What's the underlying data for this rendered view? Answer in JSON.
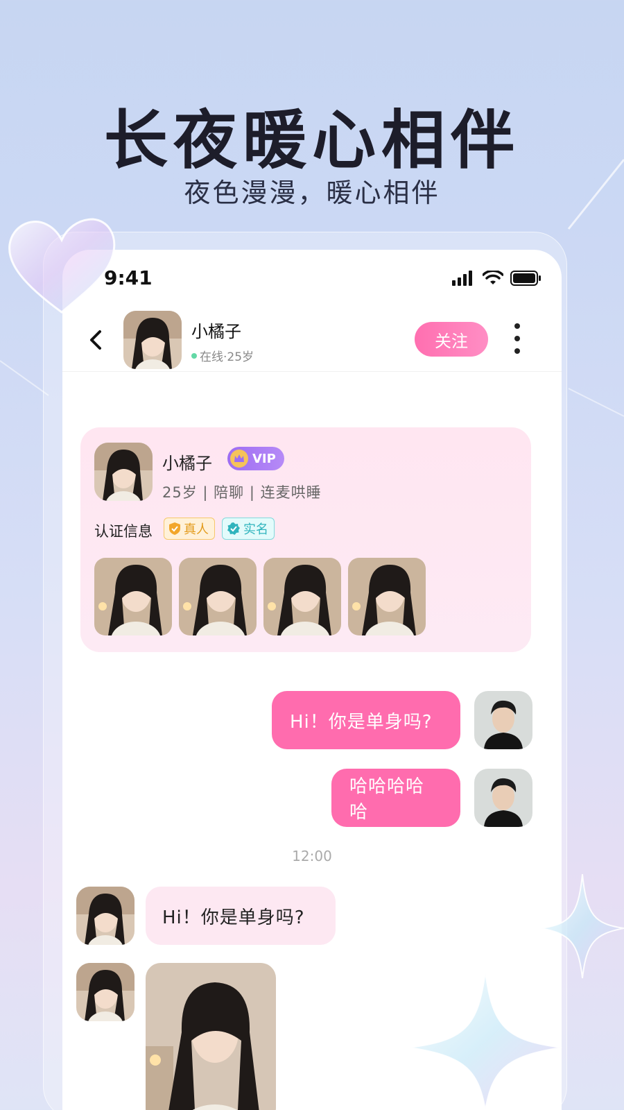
{
  "promo": {
    "headline": "长夜暖心相伴",
    "subline": "夜色漫漫，暖心相伴"
  },
  "status_bar": {
    "time": "9:41"
  },
  "chat_header": {
    "name": "小橘子",
    "status": "在线·25岁",
    "follow_label": "关注"
  },
  "profile_card": {
    "name": "小橘子",
    "vip_label": "VIP",
    "tags": "25岁 | 陪聊 | 连麦哄睡",
    "cert_label": "认证信息",
    "badges": [
      {
        "label": "真人",
        "color": "#e39b1b"
      },
      {
        "label": "实名",
        "color": "#2fb4bd"
      }
    ],
    "photo_count": 4
  },
  "messages": [
    {
      "from": "me",
      "text": "Hi！你是单身吗?"
    },
    {
      "from": "me",
      "text": "哈哈哈哈哈"
    },
    {
      "from": "system",
      "text": "12:00"
    },
    {
      "from": "her",
      "text": "Hi！你是单身吗?"
    },
    {
      "from": "her",
      "type": "photo"
    }
  ],
  "colors": {
    "accent_pink": "#ff6cae",
    "vip_purple": "#9d6df2",
    "card_bg": "#ffe6f1"
  }
}
